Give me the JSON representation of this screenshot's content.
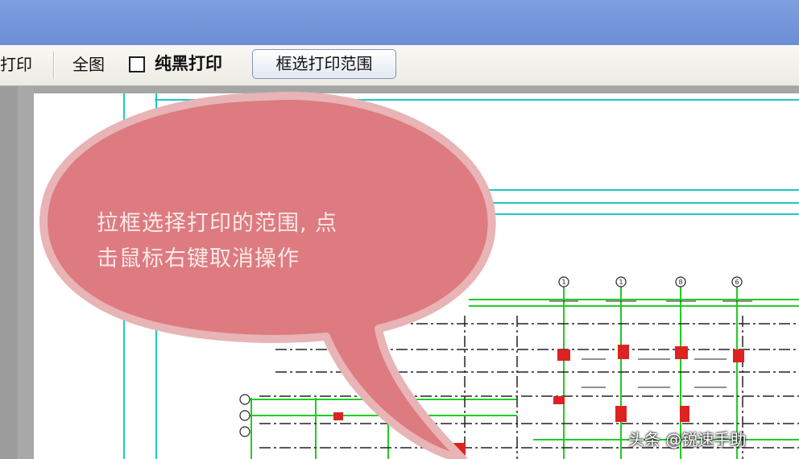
{
  "toolbar": {
    "print_label": "打印",
    "full_view_label": "全图",
    "pure_black_label": "纯黑打印",
    "pure_black_checked": false,
    "select_range_button": "框选打印范围"
  },
  "drawing": {
    "axis_labels": [
      "1",
      "1",
      "8",
      "6"
    ],
    "colors": {
      "cyan": "#1ec8c8",
      "green": "#22cc22",
      "red": "#dd2222",
      "dark": "#222222"
    }
  },
  "callout": {
    "line1": "拉框选择打印的范围, 点",
    "line2": "击鼠标右键取消操作",
    "fill": "#dd7b80",
    "border": "#e8b4b6"
  },
  "watermark": "头条 @锐速手助"
}
